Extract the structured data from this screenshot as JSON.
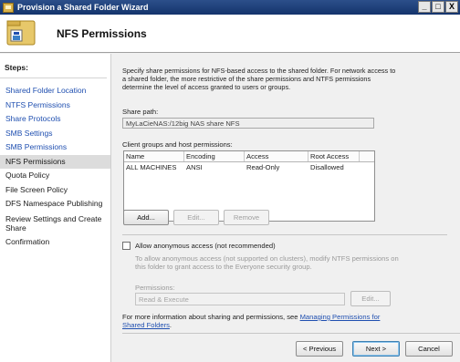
{
  "window": {
    "title": "Provision a Shared Folder Wizard",
    "buttons": {
      "minimize": "_",
      "maximize": "□",
      "close": "X"
    }
  },
  "header": {
    "title": "NFS Permissions"
  },
  "sidebar": {
    "title": "Steps:",
    "items": [
      {
        "label": "Shared Folder Location",
        "state": "link"
      },
      {
        "label": "NTFS Permissions",
        "state": "link"
      },
      {
        "label": "Share Protocols",
        "state": "link"
      },
      {
        "label": "SMB Settings",
        "state": "link"
      },
      {
        "label": "SMB Permissions",
        "state": "link"
      },
      {
        "label": "NFS Permissions",
        "state": "current"
      },
      {
        "label": "Quota Policy",
        "state": "plain"
      },
      {
        "label": "File Screen Policy",
        "state": "plain"
      },
      {
        "label": "DFS Namespace Publishing",
        "state": "plain"
      },
      {
        "label": "Review Settings and Create Share",
        "state": "plain"
      },
      {
        "label": "Confirmation",
        "state": "plain"
      }
    ]
  },
  "main": {
    "description": "Specify share permissions for NFS-based access to the shared folder. For network access to a shared folder, the more restrictive of the share permissions and NTFS permissions determine the level of access granted to users or groups.",
    "share_path_label": "Share path:",
    "share_path_value": "MyLaCieNAS:/12big NAS share NFS",
    "client_groups_label": "Client groups and host permissions:",
    "table": {
      "columns": [
        "Name",
        "Encoding",
        "Access",
        "Root Access"
      ],
      "rows": [
        [
          "ALL MACHINES",
          "ANSI",
          "Read-Only",
          "Disallowed"
        ]
      ]
    },
    "add_button": "Add...",
    "edit_button": "Edit...",
    "remove_button": "Remove",
    "anonymous_checkbox_label": "Allow anonymous access (not recommended)",
    "anonymous_help": "To allow anonymous access (not supported on clusters), modify NTFS permissions on this folder to grant access to the Everyone security group.",
    "permissions_label": "Permissions:",
    "permissions_value": "Read & Execute",
    "permissions_edit_button": "Edit...",
    "more_info_prefix": "For more information about sharing and permissions, see ",
    "more_info_link": "Managing Permissions for Shared Folders",
    "more_info_suffix": "."
  },
  "footer": {
    "previous_button": "< Previous",
    "next_button": "Next >",
    "cancel_button": "Cancel"
  }
}
